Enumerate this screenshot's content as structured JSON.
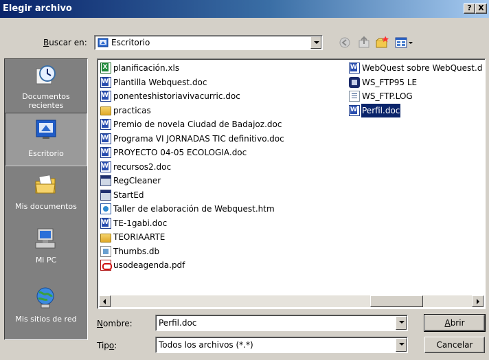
{
  "window": {
    "title": "Elegir archivo",
    "help_glyph": "?",
    "close_glyph": "X"
  },
  "lookin": {
    "label_prefix": "",
    "label_key": "B",
    "label_rest": "uscar en:",
    "value": "Escritorio",
    "icon": "desktop-icon"
  },
  "toolbar": {
    "icons": [
      "back-icon",
      "up-folder-icon",
      "new-folder-icon",
      "view-menu-icon"
    ]
  },
  "places": [
    {
      "label": "Documentos recientes",
      "icon": "recent-documents-icon",
      "selected": false
    },
    {
      "label": "Escritorio",
      "icon": "desktop-icon",
      "selected": true
    },
    {
      "label": "Mis documentos",
      "icon": "my-documents-icon",
      "selected": false
    },
    {
      "label": "Mi PC",
      "icon": "my-computer-icon",
      "selected": false
    },
    {
      "label": "Mis sitios de red",
      "icon": "network-places-icon",
      "selected": false
    }
  ],
  "files": {
    "column1": [
      {
        "name": "planificación.xls",
        "type": "xls"
      },
      {
        "name": "Plantilla Webquest.doc",
        "type": "word"
      },
      {
        "name": "ponenteshistoriavivacurric.doc",
        "type": "word"
      },
      {
        "name": "practicas",
        "type": "folder"
      },
      {
        "name": "Premio de novela Ciudad de Badajoz.doc",
        "type": "word"
      },
      {
        "name": "Programa VI JORNADAS TIC definitivo.doc",
        "type": "word"
      },
      {
        "name": "PROYECTO 04-05 ECOLOGIA.doc",
        "type": "word"
      },
      {
        "name": "recursos2.doc",
        "type": "word"
      },
      {
        "name": "RegCleaner",
        "type": "exe"
      },
      {
        "name": "StartEd",
        "type": "exe"
      },
      {
        "name": "Taller de elaboración de Webquest.htm",
        "type": "htm"
      },
      {
        "name": "TE-1gabi.doc",
        "type": "word"
      },
      {
        "name": "TEORIAARTE",
        "type": "folder"
      },
      {
        "name": "Thumbs.db",
        "type": "db"
      },
      {
        "name": "usodeagenda.pdf",
        "type": "pdf"
      }
    ],
    "column2": [
      {
        "name": "WebQuest sobre WebQuest.d",
        "type": "word",
        "selected": false
      },
      {
        "name": "WS_FTP95 LE",
        "type": "ftp",
        "selected": false
      },
      {
        "name": "WS_FTP.LOG",
        "type": "log",
        "selected": false
      },
      {
        "name": "Perfil.doc",
        "type": "word",
        "selected": true
      }
    ]
  },
  "filename": {
    "label_key": "N",
    "label_rest": "ombre:",
    "value": "Perfil.doc"
  },
  "filetype": {
    "label_prefix": "Tip",
    "label_key": "o",
    "label_rest": ":",
    "value": "Todos los archivos (*.*)"
  },
  "buttons": {
    "open_key": "A",
    "open_rest": "brir",
    "cancel": "Cancelar"
  }
}
